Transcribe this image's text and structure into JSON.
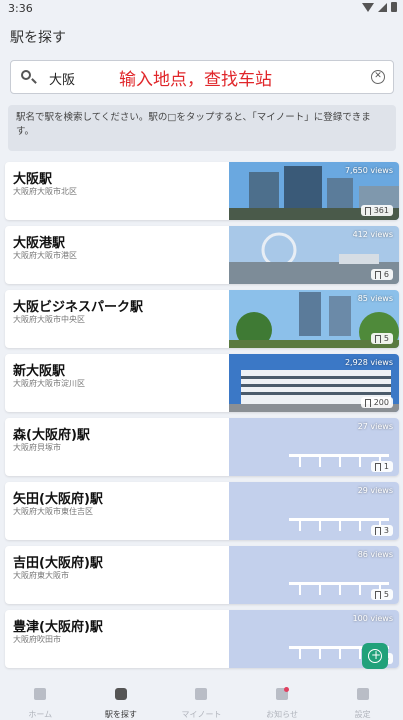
{
  "status": {
    "time": "3:36"
  },
  "appbar": {
    "title": "駅を探す"
  },
  "search": {
    "value": "大阪",
    "overlay_text": "输入地点，查找车站"
  },
  "info": {
    "text": "駅名で駅を検索してください。駅の□をタップすると、「マイノート」に登録できます。"
  },
  "stations": [
    {
      "name": "大阪駅",
      "address": "大阪府大阪市北区",
      "views": "7,650 views",
      "saves": "361",
      "photo": "city"
    },
    {
      "name": "大阪港駅",
      "address": "大阪府大阪市港区",
      "views": "412 views",
      "saves": "6",
      "photo": "harbor"
    },
    {
      "name": "大阪ビジネスパーク駅",
      "address": "大阪府大阪市中央区",
      "views": "85 views",
      "saves": "5",
      "photo": "park"
    },
    {
      "name": "新大阪駅",
      "address": "大阪府大阪市淀川区",
      "views": "2,928 views",
      "saves": "200",
      "photo": "building"
    },
    {
      "name": "森(大阪府)駅",
      "address": "大阪府貝塚市",
      "views": "27 views",
      "saves": "1",
      "photo": "placeholder"
    },
    {
      "name": "矢田(大阪府)駅",
      "address": "大阪府大阪市東住吉区",
      "views": "29 views",
      "saves": "3",
      "photo": "placeholder"
    },
    {
      "name": "吉田(大阪府)駅",
      "address": "大阪府東大阪市",
      "views": "86 views",
      "saves": "5",
      "photo": "placeholder"
    },
    {
      "name": "豊津(大阪府)駅",
      "address": "大阪府吹田市",
      "views": "100 views",
      "saves": "5",
      "photo": "placeholder"
    }
  ],
  "nav": [
    {
      "label": "ホーム",
      "icon": "home-icon",
      "active": false
    },
    {
      "label": "駅を探す",
      "icon": "train-icon",
      "active": true
    },
    {
      "label": "マイノート",
      "icon": "bookmark-icon",
      "active": false
    },
    {
      "label": "お知らせ",
      "icon": "bell-icon",
      "active": false
    },
    {
      "label": "設定",
      "icon": "gear-icon",
      "active": false
    }
  ]
}
